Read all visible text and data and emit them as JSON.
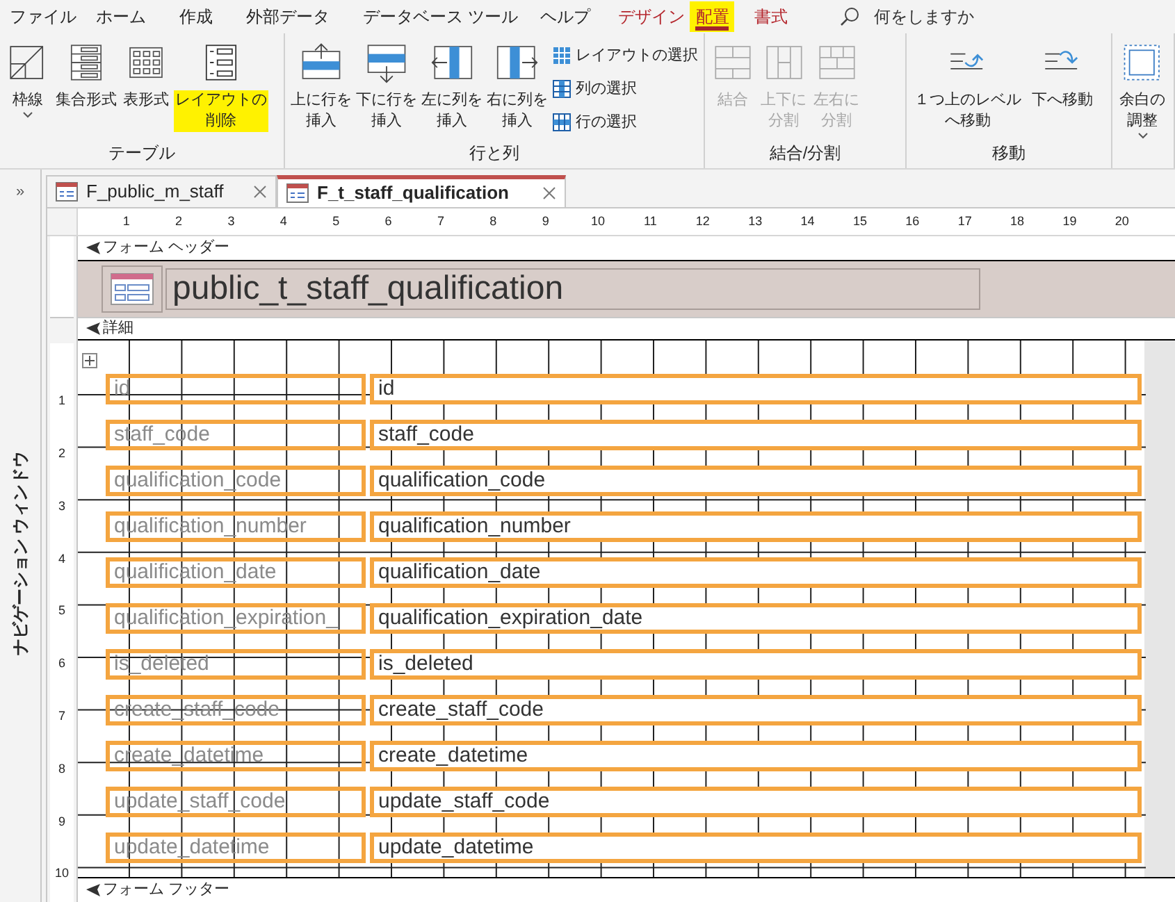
{
  "menu_tabs": [
    {
      "label": "ファイル",
      "kind": "normal",
      "selected": false,
      "highlighted": false
    },
    {
      "label": "ホーム",
      "kind": "normal",
      "selected": false,
      "highlighted": false
    },
    {
      "label": "作成",
      "kind": "normal",
      "selected": false,
      "highlighted": false
    },
    {
      "label": "外部データ",
      "kind": "normal",
      "selected": false,
      "highlighted": false
    },
    {
      "label": "データベース ツール",
      "kind": "normal",
      "selected": false,
      "highlighted": false
    },
    {
      "label": "ヘルプ",
      "kind": "normal",
      "selected": false,
      "highlighted": false
    },
    {
      "label": "デザイン",
      "kind": "contextual",
      "selected": false,
      "highlighted": false
    },
    {
      "label": "配置",
      "kind": "contextual",
      "selected": true,
      "highlighted": true
    },
    {
      "label": "書式",
      "kind": "contextual",
      "selected": false,
      "highlighted": false
    }
  ],
  "search": {
    "placeholder": "何をしますか"
  },
  "ribbon_groups": [
    {
      "label": "テーブル",
      "buttons": [
        {
          "label": "枠線",
          "kind": "large",
          "caret": true,
          "disabled": false,
          "highlighted": false
        },
        {
          "label": "集合形式",
          "kind": "large",
          "disabled": false,
          "highlighted": false
        },
        {
          "label": "表形式",
          "kind": "large",
          "disabled": false,
          "highlighted": false
        },
        {
          "label": "レイアウトの削除",
          "kind": "large",
          "disabled": false,
          "highlighted": true
        }
      ]
    },
    {
      "label": "行と列",
      "buttons": [
        {
          "label": "上に行を挿入",
          "kind": "large",
          "disabled": false,
          "highlighted": false
        },
        {
          "label": "下に行を挿入",
          "kind": "large",
          "disabled": false,
          "highlighted": false
        },
        {
          "label": "左に列を挿入",
          "kind": "large",
          "disabled": false,
          "highlighted": false
        },
        {
          "label": "右に列を挿入",
          "kind": "large",
          "disabled": false,
          "highlighted": false
        },
        {
          "label": "レイアウトの選択",
          "kind": "small",
          "disabled": false,
          "highlighted": false
        },
        {
          "label": "列の選択",
          "kind": "small",
          "disabled": false,
          "highlighted": false
        },
        {
          "label": "行の選択",
          "kind": "small",
          "disabled": false,
          "highlighted": false
        }
      ]
    },
    {
      "label": "結合/分割",
      "buttons": [
        {
          "label": "結合",
          "kind": "large",
          "disabled": true,
          "highlighted": false
        },
        {
          "label": "上下に分割",
          "kind": "large",
          "disabled": true,
          "highlighted": false
        },
        {
          "label": "左右に分割",
          "kind": "large",
          "disabled": true,
          "highlighted": false
        }
      ]
    },
    {
      "label": "移動",
      "buttons": [
        {
          "label": "１つ上のレベルへ移動",
          "kind": "large",
          "disabled": false,
          "highlighted": false
        },
        {
          "label": "下へ移動",
          "kind": "large",
          "disabled": false,
          "highlighted": false
        }
      ]
    },
    {
      "buttons": [
        {
          "label": "余白の調整",
          "kind": "large",
          "caret": true,
          "disabled": false,
          "highlighted": false
        }
      ]
    }
  ],
  "navigation_pane": {
    "toggle": "»",
    "title": "ナビゲーション ウィンドウ"
  },
  "document_tabs": [
    {
      "label": "F_public_m_staff",
      "selected": false
    },
    {
      "label": "F_t_staff_qualification",
      "selected": true
    }
  ],
  "ruler": {
    "horizontal": [
      "1",
      "2",
      "3",
      "4",
      "5",
      "6",
      "7",
      "8",
      "9",
      "10",
      "11",
      "12",
      "13",
      "14",
      "15",
      "16",
      "17",
      "18",
      "19",
      "20"
    ],
    "vertical": [
      "1",
      "2",
      "3",
      "4",
      "5",
      "6",
      "7",
      "8",
      "9",
      "10"
    ]
  },
  "form": {
    "header_label": "フォーム ヘッダー",
    "title": "public_t_staff_qualification",
    "detail_label": "詳細",
    "fields": [
      {
        "label": "id",
        "control": "id"
      },
      {
        "label": "staff_code",
        "control": "staff_code"
      },
      {
        "label": "qualification_code",
        "control": "qualification_code"
      },
      {
        "label": "qualification_number",
        "control": "qualification_number"
      },
      {
        "label": "qualification_date",
        "control": "qualification_date"
      },
      {
        "label": "qualification_expiration_",
        "control": "qualification_expiration_date"
      },
      {
        "label": "is_deleted",
        "control": "is_deleted"
      },
      {
        "label": "create_staff_code",
        "control": "create_staff_code"
      },
      {
        "label": "create_datetime",
        "control": "create_datetime"
      },
      {
        "label": "update_staff_code",
        "control": "update_staff_code"
      },
      {
        "label": "update_datetime",
        "control": "update_datetime"
      }
    ],
    "footer_label": "フォーム フッター"
  }
}
